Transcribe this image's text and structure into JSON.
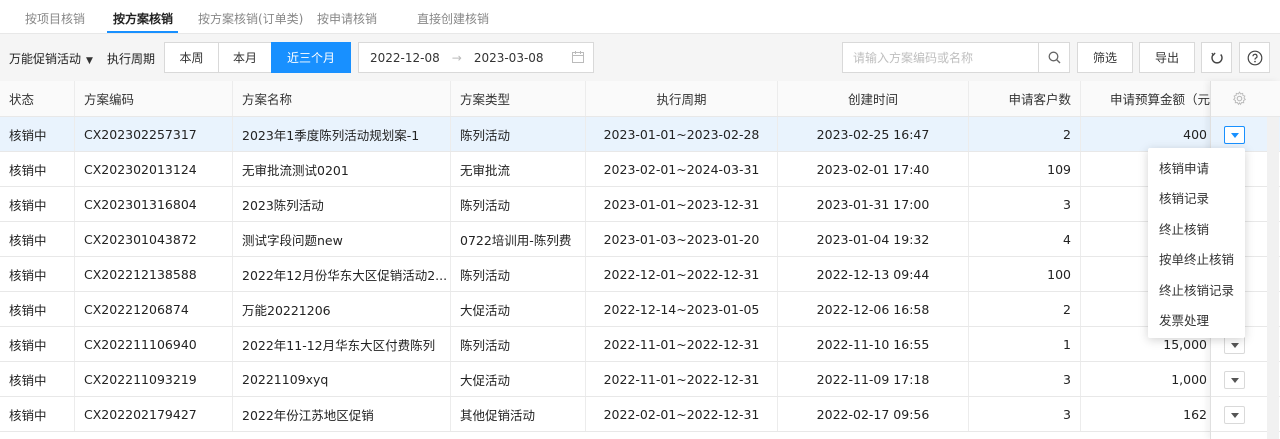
{
  "tabs": [
    {
      "label": "按项目核销",
      "active": false
    },
    {
      "label": "按方案核销",
      "active": true
    },
    {
      "label": "按方案核销(订单类)",
      "active": false
    },
    {
      "label": "按申请核销",
      "active": false
    },
    {
      "label": "直接创建核销",
      "active": false
    }
  ],
  "toolbar": {
    "promo_type": "万能促销活动",
    "period_label": "执行周期",
    "period_options": [
      {
        "label": "本周",
        "active": false
      },
      {
        "label": "本月",
        "active": false
      },
      {
        "label": "近三个月",
        "active": true
      }
    ],
    "date_start": "2022-12-08",
    "date_end": "2023-03-08",
    "search_placeholder": "请输入方案编码或名称",
    "filter_label": "筛选",
    "export_label": "导出"
  },
  "table": {
    "columns": [
      "状态",
      "方案编码",
      "方案名称",
      "方案类型",
      "执行周期",
      "创建时间",
      "申请客户数",
      "申请预算金额（元"
    ],
    "rows": [
      [
        "核销中",
        "CX202302257317",
        "2023年1季度陈列活动规划案-1",
        "陈列活动",
        "2023-01-01~2023-02-28",
        "2023-02-25 16:47",
        "2",
        "400"
      ],
      [
        "核销中",
        "CX202302013124",
        "无审批流测试0201",
        "无审批流",
        "2023-02-01~2024-03-31",
        "2023-02-01 17:40",
        "109",
        ""
      ],
      [
        "核销中",
        "CX202301316804",
        "2023陈列活动",
        "陈列活动",
        "2023-01-01~2023-12-31",
        "2023-01-31 17:00",
        "3",
        ""
      ],
      [
        "核销中",
        "CX202301043872",
        "测试字段问题new",
        "0722培训用-陈列费",
        "2023-01-03~2023-01-20",
        "2023-01-04 19:32",
        "4",
        ""
      ],
      [
        "核销中",
        "CX202212138588",
        "2022年12月份华东大区促销活动2...",
        "陈列活动",
        "2022-12-01~2022-12-31",
        "2022-12-13 09:44",
        "100",
        ""
      ],
      [
        "核销中",
        "CX20221206874",
        "万能20221206",
        "大促活动",
        "2022-12-14~2023-01-05",
        "2022-12-06 16:58",
        "2",
        ""
      ],
      [
        "核销中",
        "CX202211106940",
        "2022年11-12月华东大区付费陈列",
        "陈列活动",
        "2022-11-01~2022-12-31",
        "2022-11-10 16:55",
        "1",
        "15,000"
      ],
      [
        "核销中",
        "CX202211093219",
        "20221109xyq",
        "大促活动",
        "2022-11-01~2022-12-31",
        "2022-11-09 17:18",
        "3",
        "1,000"
      ],
      [
        "核销中",
        "CX202202179427",
        "2022年份江苏地区促销",
        "其他促销活动",
        "2022-02-01~2022-12-31",
        "2022-02-17 09:56",
        "3",
        "162"
      ]
    ]
  },
  "dropdown": {
    "items": [
      "核销申请",
      "核销记录",
      "终止核销",
      "按单终止核销",
      "终止核销记录",
      "发票处理"
    ]
  },
  "colors": {
    "accent": "#1890ff",
    "row_highlight": "#e9f3fd"
  }
}
